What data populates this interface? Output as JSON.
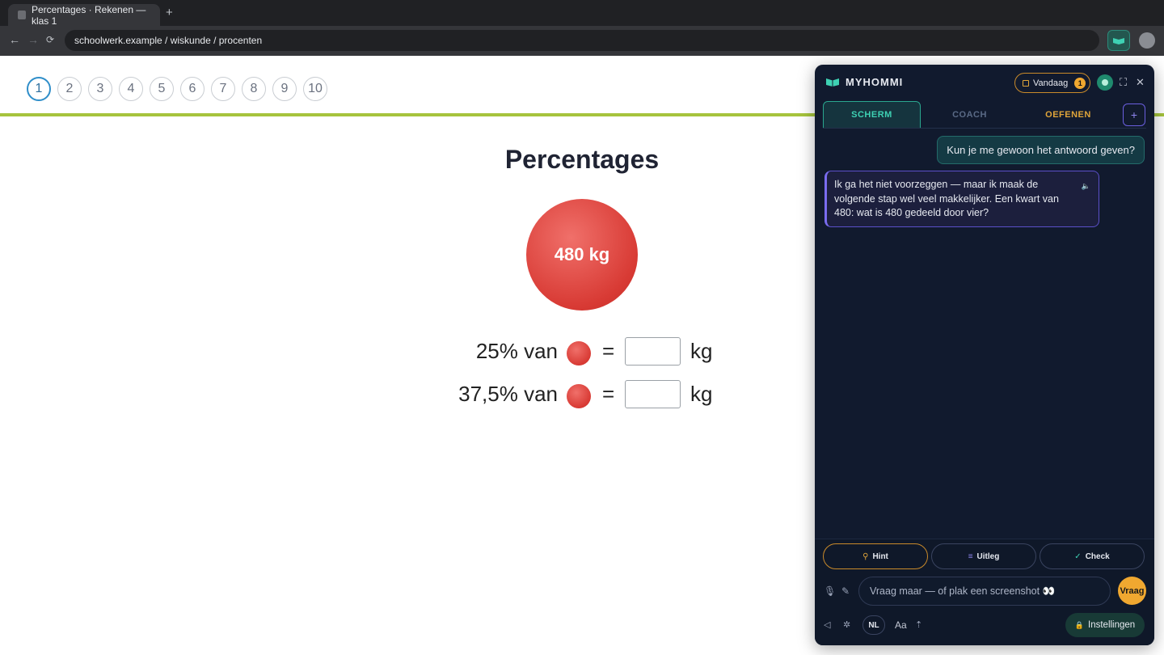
{
  "browser": {
    "tab_title": "Percentages · Rekenen — klas 1",
    "new_tab": "+",
    "back": "←",
    "forward": "→",
    "reload": "⟳",
    "url": "schoolwerk.example / wiskunde / procenten"
  },
  "page": {
    "questions": [
      "1",
      "2",
      "3",
      "4",
      "5",
      "6",
      "7",
      "8",
      "9",
      "10"
    ],
    "active_question": "1",
    "title": "Percentages",
    "ball_label": "480 kg",
    "rows": [
      {
        "percent": "25% van",
        "equals": "=",
        "answer": "",
        "unit": "kg"
      },
      {
        "percent": "37,5% van",
        "equals": "=",
        "answer": "",
        "unit": "kg"
      }
    ],
    "accent_color": "#a6c43d",
    "ball_color": "#d83a34"
  },
  "assistant": {
    "name": "MYHOMMI",
    "today_label": "Vandaag",
    "today_badge": "1",
    "tabs": {
      "screen": "SCHERM",
      "coach": "COACH",
      "practice": "OEFENEN"
    },
    "add": "+",
    "user_message": "Kun je me gewoon het antwoord geven?",
    "assistant_message": "Ik ga het niet voorzeggen — maar ik maak de volgende stap wel veel makkelijker. Een kwart van 480: wat is 480 gedeeld door vier?",
    "actions": {
      "hint": "Hint",
      "explain": "Uitleg",
      "check": "Check"
    },
    "input_placeholder": "Vraag maar — of plak een screenshot 👀",
    "send": "Vraag",
    "language": "NL",
    "text_size": "Aa",
    "settings": "Instellingen",
    "icons": [
      "book-logo-icon",
      "calendar-icon",
      "robot-icon",
      "expand-icon",
      "close-icon",
      "speaker-icon",
      "bulb-icon",
      "lines-icon",
      "check-icon",
      "mic-icon",
      "pencil-icon",
      "volume-icon",
      "brightness-icon",
      "upload-icon",
      "lock-icon"
    ]
  }
}
